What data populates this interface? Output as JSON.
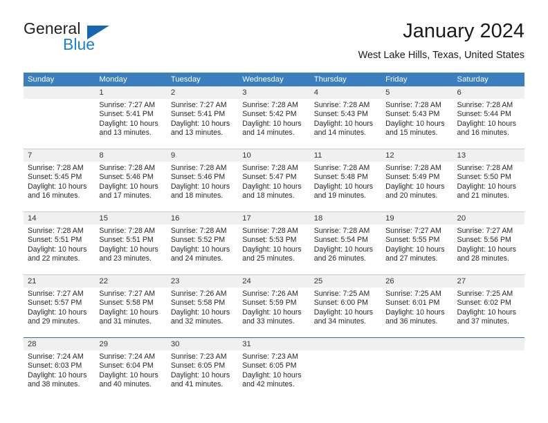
{
  "brand": {
    "name_part1": "General",
    "name_part2": "Blue",
    "triangle_color": "#1567b1",
    "blue_color": "#1b7fd4"
  },
  "header": {
    "title": "January 2024",
    "subtitle": "West Lake Hills, Texas, United States"
  },
  "theme": {
    "header_row_bg": "#3b7fbf",
    "daynum_band_bg": "#f0f0f0",
    "week_divider": "#c9c9c9",
    "last_week_divider": "#2a6ca8"
  },
  "weekdays": [
    "Sunday",
    "Monday",
    "Tuesday",
    "Wednesday",
    "Thursday",
    "Friday",
    "Saturday"
  ],
  "weeks": [
    {
      "days": [
        {
          "num": "",
          "l1": "",
          "l2": "",
          "l3": "",
          "l4": ""
        },
        {
          "num": "1",
          "l1": "Sunrise: 7:27 AM",
          "l2": "Sunset: 5:41 PM",
          "l3": "Daylight: 10 hours",
          "l4": "and 13 minutes."
        },
        {
          "num": "2",
          "l1": "Sunrise: 7:27 AM",
          "l2": "Sunset: 5:41 PM",
          "l3": "Daylight: 10 hours",
          "l4": "and 13 minutes."
        },
        {
          "num": "3",
          "l1": "Sunrise: 7:28 AM",
          "l2": "Sunset: 5:42 PM",
          "l3": "Daylight: 10 hours",
          "l4": "and 14 minutes."
        },
        {
          "num": "4",
          "l1": "Sunrise: 7:28 AM",
          "l2": "Sunset: 5:43 PM",
          "l3": "Daylight: 10 hours",
          "l4": "and 14 minutes."
        },
        {
          "num": "5",
          "l1": "Sunrise: 7:28 AM",
          "l2": "Sunset: 5:43 PM",
          "l3": "Daylight: 10 hours",
          "l4": "and 15 minutes."
        },
        {
          "num": "6",
          "l1": "Sunrise: 7:28 AM",
          "l2": "Sunset: 5:44 PM",
          "l3": "Daylight: 10 hours",
          "l4": "and 16 minutes."
        }
      ]
    },
    {
      "days": [
        {
          "num": "7",
          "l1": "Sunrise: 7:28 AM",
          "l2": "Sunset: 5:45 PM",
          "l3": "Daylight: 10 hours",
          "l4": "and 16 minutes."
        },
        {
          "num": "8",
          "l1": "Sunrise: 7:28 AM",
          "l2": "Sunset: 5:46 PM",
          "l3": "Daylight: 10 hours",
          "l4": "and 17 minutes."
        },
        {
          "num": "9",
          "l1": "Sunrise: 7:28 AM",
          "l2": "Sunset: 5:46 PM",
          "l3": "Daylight: 10 hours",
          "l4": "and 18 minutes."
        },
        {
          "num": "10",
          "l1": "Sunrise: 7:28 AM",
          "l2": "Sunset: 5:47 PM",
          "l3": "Daylight: 10 hours",
          "l4": "and 18 minutes."
        },
        {
          "num": "11",
          "l1": "Sunrise: 7:28 AM",
          "l2": "Sunset: 5:48 PM",
          "l3": "Daylight: 10 hours",
          "l4": "and 19 minutes."
        },
        {
          "num": "12",
          "l1": "Sunrise: 7:28 AM",
          "l2": "Sunset: 5:49 PM",
          "l3": "Daylight: 10 hours",
          "l4": "and 20 minutes."
        },
        {
          "num": "13",
          "l1": "Sunrise: 7:28 AM",
          "l2": "Sunset: 5:50 PM",
          "l3": "Daylight: 10 hours",
          "l4": "and 21 minutes."
        }
      ]
    },
    {
      "days": [
        {
          "num": "14",
          "l1": "Sunrise: 7:28 AM",
          "l2": "Sunset: 5:51 PM",
          "l3": "Daylight: 10 hours",
          "l4": "and 22 minutes."
        },
        {
          "num": "15",
          "l1": "Sunrise: 7:28 AM",
          "l2": "Sunset: 5:51 PM",
          "l3": "Daylight: 10 hours",
          "l4": "and 23 minutes."
        },
        {
          "num": "16",
          "l1": "Sunrise: 7:28 AM",
          "l2": "Sunset: 5:52 PM",
          "l3": "Daylight: 10 hours",
          "l4": "and 24 minutes."
        },
        {
          "num": "17",
          "l1": "Sunrise: 7:28 AM",
          "l2": "Sunset: 5:53 PM",
          "l3": "Daylight: 10 hours",
          "l4": "and 25 minutes."
        },
        {
          "num": "18",
          "l1": "Sunrise: 7:28 AM",
          "l2": "Sunset: 5:54 PM",
          "l3": "Daylight: 10 hours",
          "l4": "and 26 minutes."
        },
        {
          "num": "19",
          "l1": "Sunrise: 7:27 AM",
          "l2": "Sunset: 5:55 PM",
          "l3": "Daylight: 10 hours",
          "l4": "and 27 minutes."
        },
        {
          "num": "20",
          "l1": "Sunrise: 7:27 AM",
          "l2": "Sunset: 5:56 PM",
          "l3": "Daylight: 10 hours",
          "l4": "and 28 minutes."
        }
      ]
    },
    {
      "days": [
        {
          "num": "21",
          "l1": "Sunrise: 7:27 AM",
          "l2": "Sunset: 5:57 PM",
          "l3": "Daylight: 10 hours",
          "l4": "and 29 minutes."
        },
        {
          "num": "22",
          "l1": "Sunrise: 7:27 AM",
          "l2": "Sunset: 5:58 PM",
          "l3": "Daylight: 10 hours",
          "l4": "and 31 minutes."
        },
        {
          "num": "23",
          "l1": "Sunrise: 7:26 AM",
          "l2": "Sunset: 5:58 PM",
          "l3": "Daylight: 10 hours",
          "l4": "and 32 minutes."
        },
        {
          "num": "24",
          "l1": "Sunrise: 7:26 AM",
          "l2": "Sunset: 5:59 PM",
          "l3": "Daylight: 10 hours",
          "l4": "and 33 minutes."
        },
        {
          "num": "25",
          "l1": "Sunrise: 7:25 AM",
          "l2": "Sunset: 6:00 PM",
          "l3": "Daylight: 10 hours",
          "l4": "and 34 minutes."
        },
        {
          "num": "26",
          "l1": "Sunrise: 7:25 AM",
          "l2": "Sunset: 6:01 PM",
          "l3": "Daylight: 10 hours",
          "l4": "and 36 minutes."
        },
        {
          "num": "27",
          "l1": "Sunrise: 7:25 AM",
          "l2": "Sunset: 6:02 PM",
          "l3": "Daylight: 10 hours",
          "l4": "and 37 minutes."
        }
      ]
    },
    {
      "days": [
        {
          "num": "28",
          "l1": "Sunrise: 7:24 AM",
          "l2": "Sunset: 6:03 PM",
          "l3": "Daylight: 10 hours",
          "l4": "and 38 minutes."
        },
        {
          "num": "29",
          "l1": "Sunrise: 7:24 AM",
          "l2": "Sunset: 6:04 PM",
          "l3": "Daylight: 10 hours",
          "l4": "and 40 minutes."
        },
        {
          "num": "30",
          "l1": "Sunrise: 7:23 AM",
          "l2": "Sunset: 6:05 PM",
          "l3": "Daylight: 10 hours",
          "l4": "and 41 minutes."
        },
        {
          "num": "31",
          "l1": "Sunrise: 7:23 AM",
          "l2": "Sunset: 6:05 PM",
          "l3": "Daylight: 10 hours",
          "l4": "and 42 minutes."
        },
        {
          "num": "",
          "l1": "",
          "l2": "",
          "l3": "",
          "l4": ""
        },
        {
          "num": "",
          "l1": "",
          "l2": "",
          "l3": "",
          "l4": ""
        },
        {
          "num": "",
          "l1": "",
          "l2": "",
          "l3": "",
          "l4": ""
        }
      ]
    }
  ]
}
